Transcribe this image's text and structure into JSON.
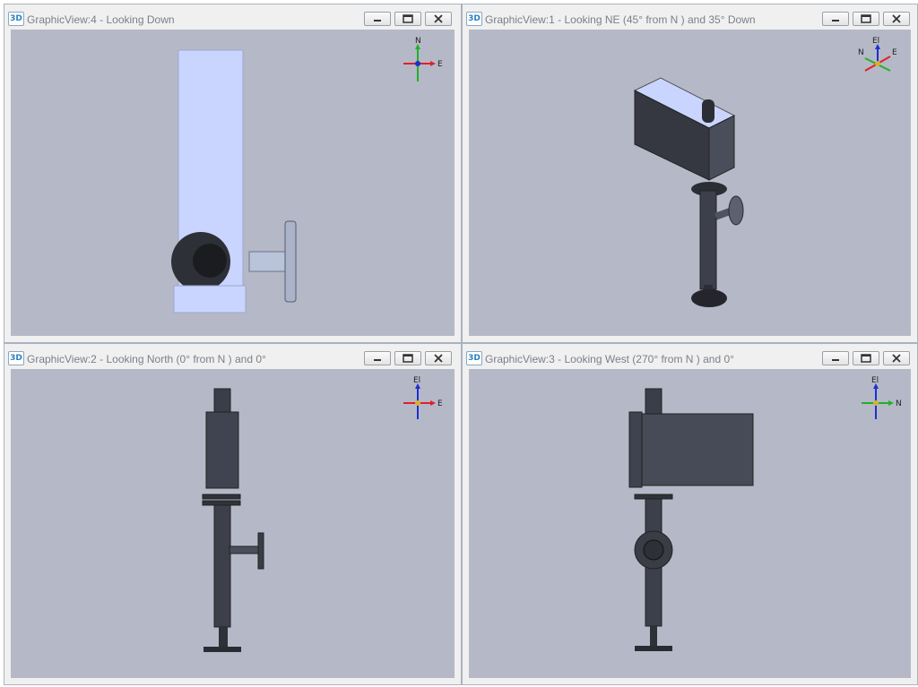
{
  "views": [
    {
      "id": "view4",
      "badge": "3D",
      "title": "GraphicView:4 - Looking Down",
      "compass": {
        "up": "N",
        "right": "E",
        "center": "El"
      }
    },
    {
      "id": "view1",
      "badge": "3D",
      "title": "GraphicView:1 - Looking NE (45° from N ) and 35° Down",
      "compass": {
        "up": "El",
        "right": "E",
        "left": "N"
      }
    },
    {
      "id": "view2",
      "badge": "3D",
      "title": "GraphicView:2 - Looking North (0° from N ) and 0°",
      "compass": {
        "up": "El",
        "right": "E"
      }
    },
    {
      "id": "view3",
      "badge": "3D",
      "title": "GraphicView:3 - Looking West (270° from N ) and 0°",
      "compass": {
        "up": "El",
        "right": "N"
      }
    }
  ],
  "colors": {
    "viewport_bg": "#b5b9c7",
    "model_dark": "#3a3d46",
    "model_light": "#c9d5ff",
    "axis_red": "#e0202a",
    "axis_green": "#22b02a",
    "axis_blue": "#1c2fd0"
  }
}
